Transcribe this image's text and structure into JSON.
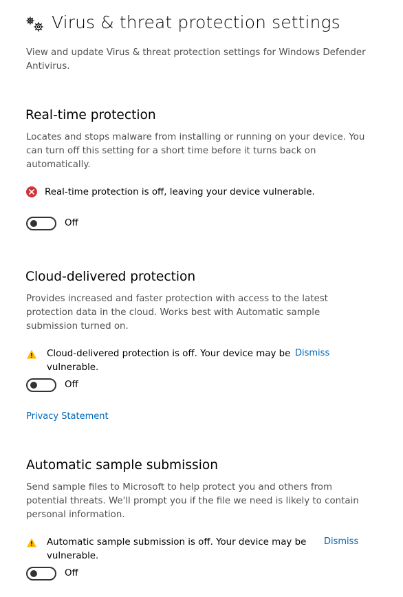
{
  "page": {
    "title": "Virus & threat protection settings",
    "description": "View and update Virus & threat protection settings for Windows Defender Antivirus.",
    "header_icon": "gears-icon"
  },
  "realtime": {
    "title": "Real-time protection",
    "description": "Locates and stops malware from installing or running on your device. You can turn off this setting for a short time before it turns back on automatically.",
    "status_icon": "error-icon",
    "status": "Real-time protection is off, leaving your device vulnerable.",
    "toggle_state": "Off"
  },
  "cloud": {
    "title": "Cloud-delivered protection",
    "description": "Provides increased and faster protection with access to the latest protection data in the cloud.  Works best with Automatic sample submission turned on.",
    "status_icon": "warning-icon",
    "status": "Cloud-delivered protection is off. Your device may be vulnerable.",
    "dismiss_label": "Dismiss",
    "toggle_state": "Off",
    "privacy_link": "Privacy Statement"
  },
  "sample": {
    "title": "Automatic sample submission",
    "description": "Send sample files to Microsoft to help protect you and others from potential threats.  We'll prompt you if the file we need is likely to contain personal information.",
    "status_icon": "warning-icon",
    "status": "Automatic sample submission is off. Your device may be vulnerable.",
    "dismiss_label": "Dismiss",
    "toggle_state": "Off"
  },
  "colors": {
    "link": "#0067b8",
    "error": "#d13438",
    "warning": "#ffb900",
    "description_text": "#505050"
  }
}
